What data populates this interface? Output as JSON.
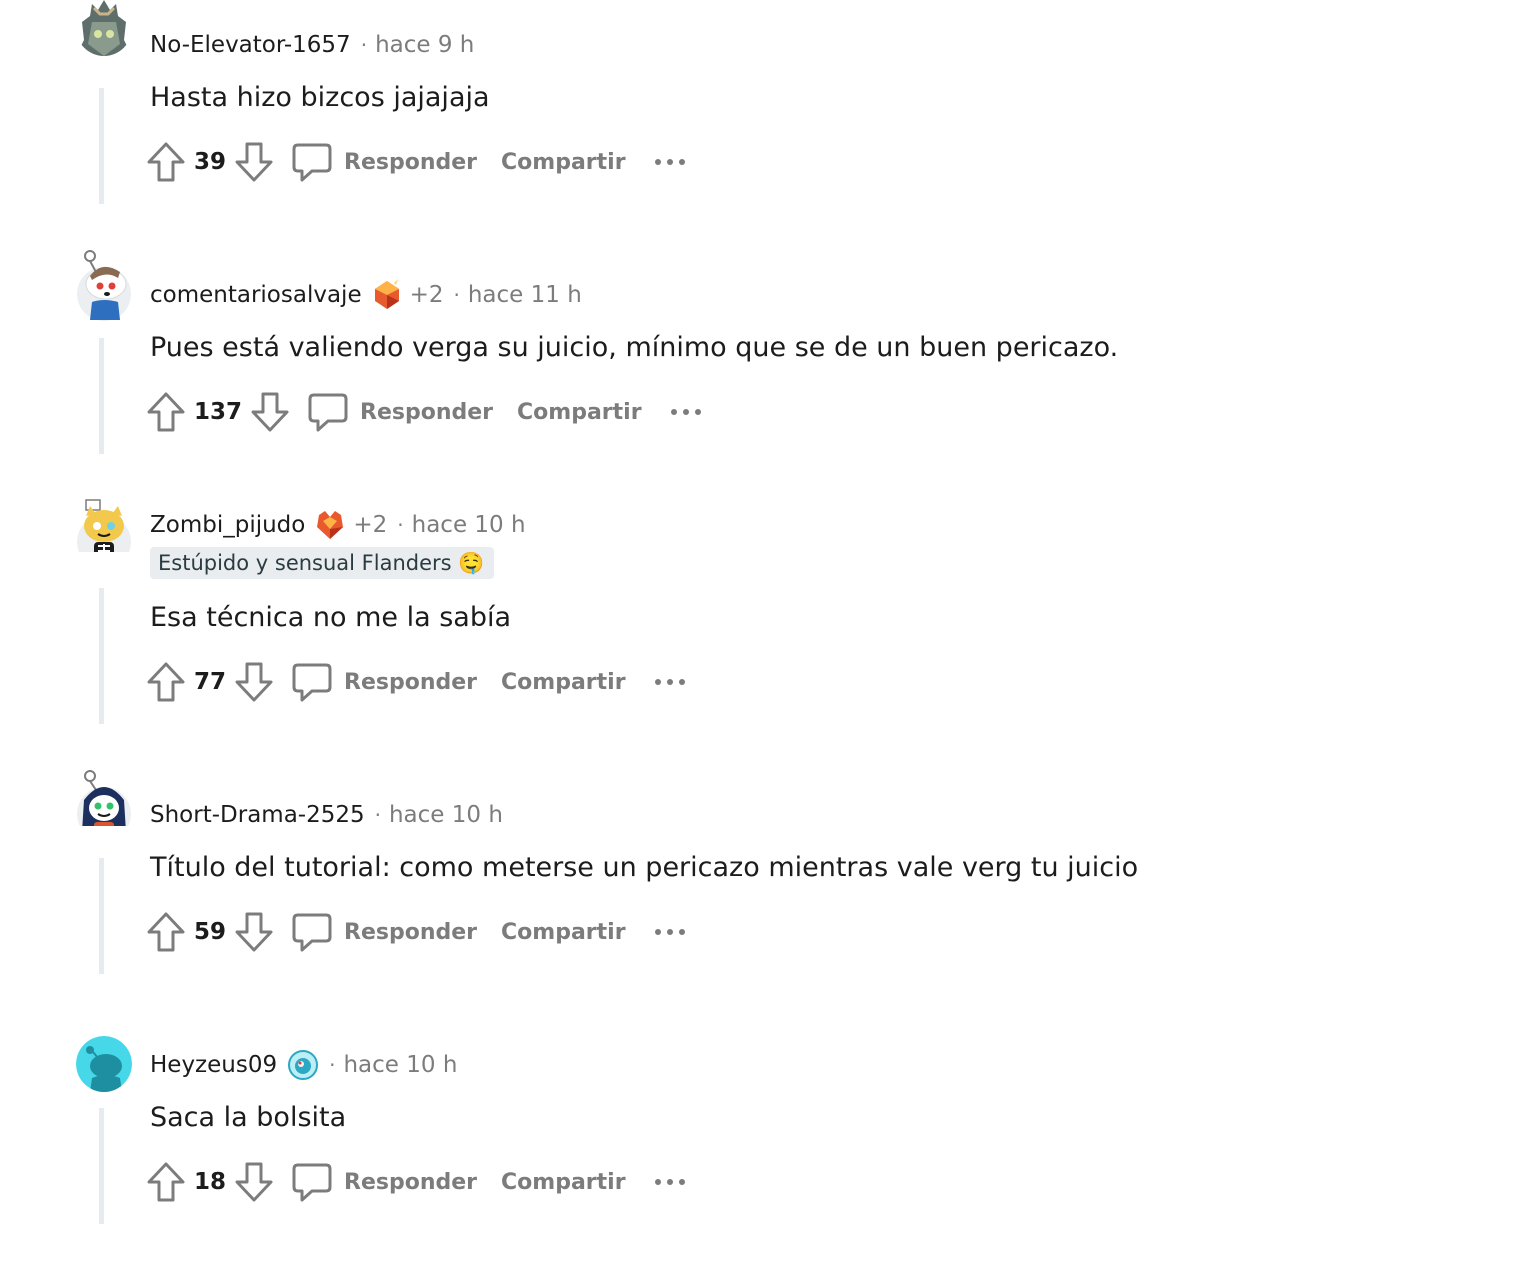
{
  "comments": [
    {
      "author": "No-Elevator-1657",
      "awards": "",
      "dot": "·",
      "time": "hace 9 h",
      "flair": "",
      "text": "Hasta hizo bizcos jajajaja",
      "score": "39",
      "avatar_icon": "robot-helmet-avatar-icon"
    },
    {
      "author": "comentariosalvaje",
      "awards": "+2",
      "dot": "·",
      "time": "hace 11 h",
      "flair": "",
      "text": "Pues está valiendo verga su juicio, mínimo que se de un buen pericazo.",
      "score": "137",
      "avatar_icon": "snoo-avatar-icon"
    },
    {
      "author": "Zombi_pijudo",
      "awards": "+2",
      "dot": "·",
      "time": "hace 10 h",
      "flair": "Estúpido y sensual Flanders 🤤",
      "text": "Esa técnica no me la sabía",
      "score": "77",
      "avatar_icon": "cat-skeleton-avatar-icon"
    },
    {
      "author": "Short-Drama-2525",
      "awards": "",
      "dot": "·",
      "time": "hace 10 h",
      "flair": "",
      "text": "Título del tutorial: como meterse un pericazo mientras vale verg tu juicio",
      "score": "59",
      "avatar_icon": "hooded-snoo-avatar-icon"
    },
    {
      "author": "Heyzeus09",
      "awards": "",
      "dot": "·",
      "time": "hace 10 h",
      "flair": "",
      "text": "Saca la bolsita",
      "score": "18",
      "avatar_icon": "default-snoo-avatar-icon"
    }
  ],
  "labels": {
    "reply": "Responder",
    "share": "Compartir"
  },
  "colors": {
    "meta_gray": "#7c7c7c",
    "thread_line": "#e5ebee",
    "flair_bg": "#eaedef",
    "default_avatar_bg": "#46d8e8"
  }
}
